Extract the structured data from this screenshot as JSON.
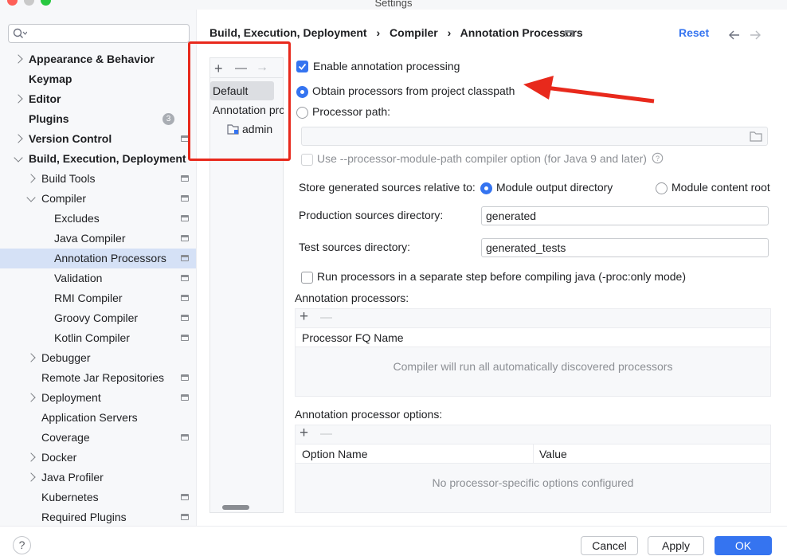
{
  "window": {
    "title": "Settings"
  },
  "colors": {
    "accent": "#3574f0",
    "annotation_red": "#e8291c",
    "selected_row": "#d5e1f6"
  },
  "search": {
    "placeholder": "",
    "icon": "search-icon"
  },
  "sidebar": {
    "items": [
      {
        "label": "Appearance & Behavior",
        "bold": true,
        "chevron": "right",
        "level": 0
      },
      {
        "label": "Keymap",
        "bold": true,
        "level": 0
      },
      {
        "label": "Editor",
        "bold": true,
        "chevron": "right",
        "level": 0
      },
      {
        "label": "Plugins",
        "bold": true,
        "level": 0,
        "badge": "3"
      },
      {
        "label": "Version Control",
        "bold": true,
        "chevron": "right",
        "level": 0,
        "page_icon": true
      },
      {
        "label": "Build, Execution, Deployment",
        "bold": true,
        "chevron": "down",
        "level": 0
      },
      {
        "label": "Build Tools",
        "chevron": "right",
        "level": 1,
        "page_icon": true
      },
      {
        "label": "Compiler",
        "chevron": "down",
        "level": 1,
        "page_icon": true
      },
      {
        "label": "Excludes",
        "level": 2,
        "page_icon": true
      },
      {
        "label": "Java Compiler",
        "level": 2,
        "page_icon": true
      },
      {
        "label": "Annotation Processors",
        "level": 2,
        "page_icon": true,
        "selected": true
      },
      {
        "label": "Validation",
        "level": 2,
        "page_icon": true
      },
      {
        "label": "RMI Compiler",
        "level": 2,
        "page_icon": true
      },
      {
        "label": "Groovy Compiler",
        "level": 2,
        "page_icon": true
      },
      {
        "label": "Kotlin Compiler",
        "level": 2,
        "page_icon": true
      },
      {
        "label": "Debugger",
        "chevron": "right",
        "level": 1
      },
      {
        "label": "Remote Jar Repositories",
        "level": 1,
        "page_icon": true
      },
      {
        "label": "Deployment",
        "chevron": "right",
        "level": 1,
        "page_icon": true
      },
      {
        "label": "Application Servers",
        "level": 1
      },
      {
        "label": "Coverage",
        "level": 1,
        "page_icon": true
      },
      {
        "label": "Docker",
        "chevron": "right",
        "level": 1
      },
      {
        "label": "Java Profiler",
        "chevron": "right",
        "level": 1
      },
      {
        "label": "Kubernetes",
        "level": 1,
        "page_icon": true
      },
      {
        "label": "Required Plugins",
        "level": 1,
        "page_icon": true
      }
    ]
  },
  "breadcrumb": {
    "parts": [
      "Build, Execution, Deployment",
      "Compiler",
      "Annotation Processors"
    ],
    "separator": "›",
    "reset": "Reset"
  },
  "profiles": {
    "toolbar": [
      "+",
      "—",
      "→"
    ],
    "default": "Default",
    "group": "Annotation prc",
    "module": "admin"
  },
  "main": {
    "enable_processing": {
      "label": "Enable annotation processing",
      "checked": true
    },
    "obtain_classpath": {
      "label": "Obtain processors from project classpath",
      "selected": true
    },
    "processor_path": {
      "label": "Processor path:",
      "selected": false,
      "value": ""
    },
    "module_path_option": {
      "label": "Use --processor-module-path compiler option (for Java 9 and later)",
      "checked": false
    },
    "store_generated": {
      "label": "Store generated sources relative to:",
      "option_output": "Module output directory",
      "option_content": "Module content root",
      "selected": "Module output directory"
    },
    "production_dir": {
      "label": "Production sources directory:",
      "value": "generated"
    },
    "test_dir": {
      "label": "Test sources directory:",
      "value": "generated_tests"
    },
    "separate_step": {
      "label": "Run processors in a separate step before compiling java (-proc:only mode)",
      "checked": false
    },
    "processors_table": {
      "title": "Annotation processors:",
      "column": "Processor FQ Name",
      "empty": "Compiler will run all automatically discovered processors"
    },
    "options_table": {
      "title": "Annotation processor options:",
      "columns": [
        "Option Name",
        "Value"
      ],
      "empty": "No processor-specific options configured"
    }
  },
  "footer": {
    "help": "?",
    "cancel": "Cancel",
    "apply": "Apply",
    "ok": "OK"
  }
}
